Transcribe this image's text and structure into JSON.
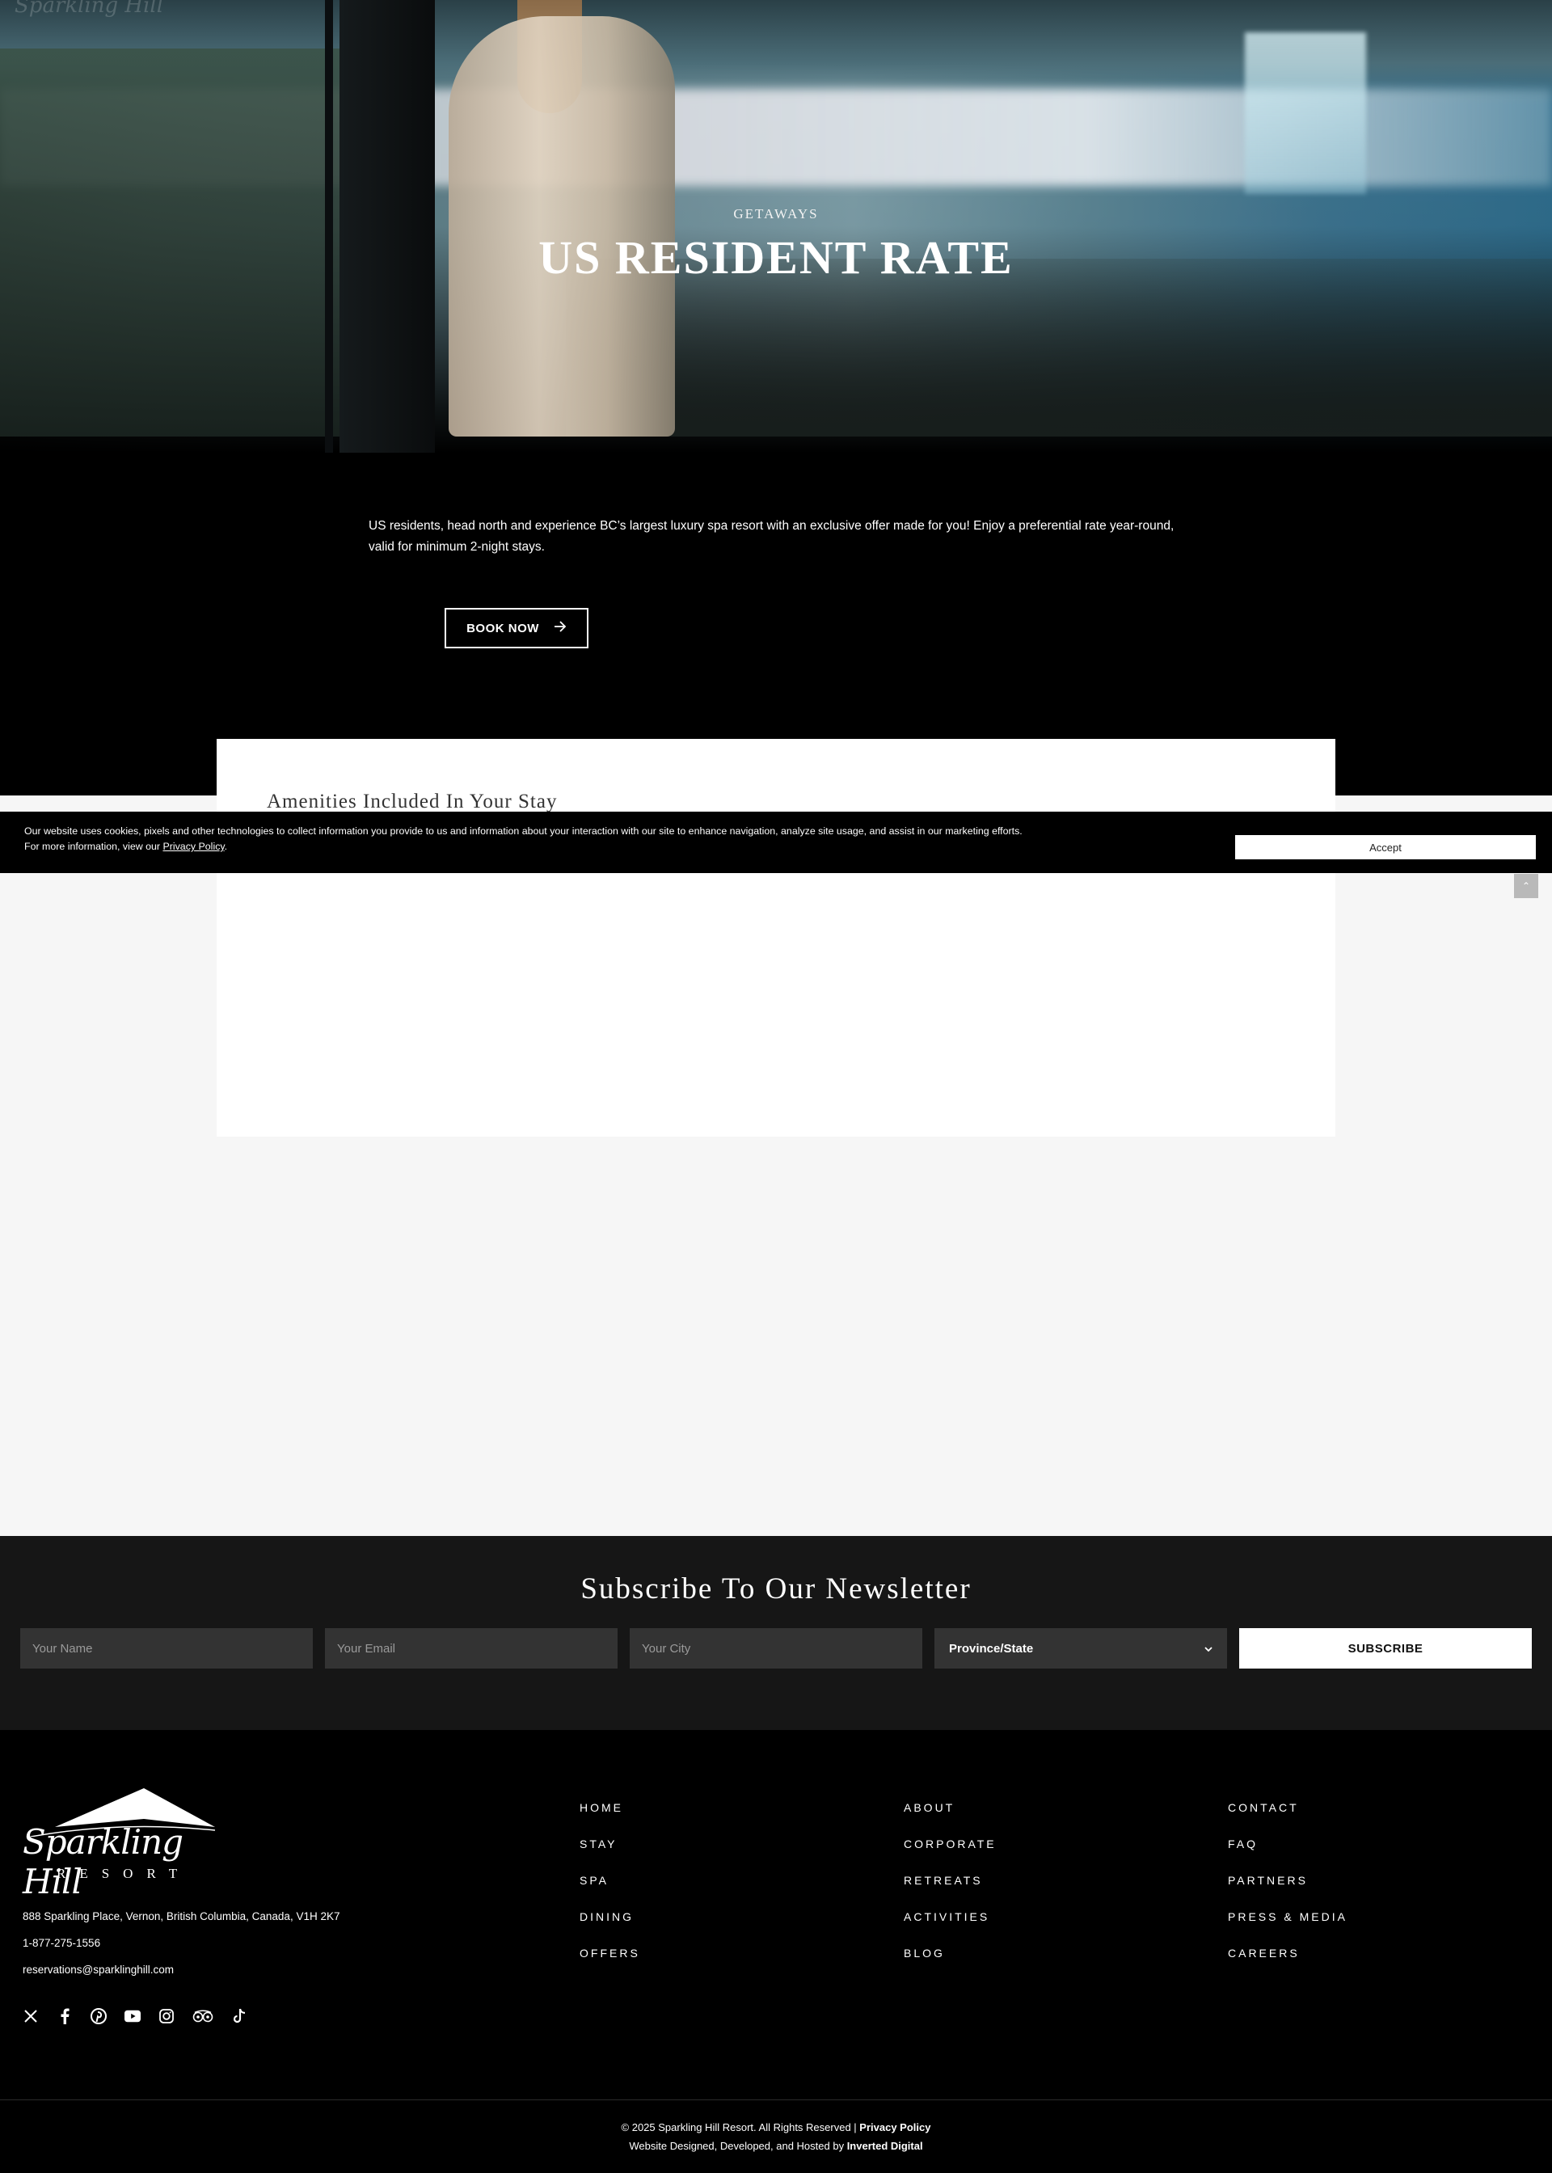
{
  "hero": {
    "watermark": "Sparkling Hill",
    "kicker": "GETAWAYS",
    "title": "US RESIDENT RATE"
  },
  "intro": {
    "text": "US residents, head north and experience BC’s largest luxury spa resort with an exclusive offer made for you! Enjoy a preferential rate year-round, valid for minimum 2-night stays.",
    "book_label": "BOOK NOW",
    "book_icon": "arrow-right-icon"
  },
  "amenities": {
    "title": "Amenities Included In Your Stay"
  },
  "cookie": {
    "line1": "Our website uses cookies, pixels and other technologies to collect information you provide to us and information about your interaction with our site to enhance navigation, analyze site usage, and assist in our marketing efforts.",
    "line2_prefix": "For more information, view our ",
    "policy_link": "Privacy Policy",
    "line2_suffix": ".",
    "accept_label": "Accept"
  },
  "scroll_top": {
    "glyph": "⌃"
  },
  "newsletter": {
    "title": "Subscribe To Our Newsletter",
    "name_placeholder": "Your Name",
    "email_placeholder": "Your Email",
    "city_placeholder": "Your City",
    "province_selected": "Province/State",
    "submit_label": "SUBSCRIBE"
  },
  "footer": {
    "logo_script": "Sparkling Hill",
    "logo_sub": "RESORT",
    "address": "888 Sparkling Place, Vernon, British Columbia, Canada, V1H 2K7",
    "phone": "1-877-275-1556",
    "email": "reservations@sparklinghill.com",
    "socials": [
      "x-icon",
      "facebook-icon",
      "pinterest-icon",
      "youtube-icon",
      "instagram-icon",
      "tripadvisor-icon",
      "tiktok-icon"
    ],
    "nav": {
      "col1": [
        "HOME",
        "STAY",
        "SPA",
        "DINING",
        "OFFERS"
      ],
      "col2": [
        "ABOUT",
        "CORPORATE",
        "RETREATS",
        "ACTIVITIES",
        "BLOG"
      ],
      "col3": [
        "CONTACT",
        "FAQ",
        "PARTNERS",
        "PRESS & MEDIA",
        "CAREERS"
      ]
    },
    "copyright_text": "© 2025 Sparkling Hill Resort. All Rights Reserved | ",
    "copyright_link": "Privacy Policy",
    "credit_text": "Website Designed, Developed, and Hosted by ",
    "credit_link": "Inverted Digital"
  }
}
